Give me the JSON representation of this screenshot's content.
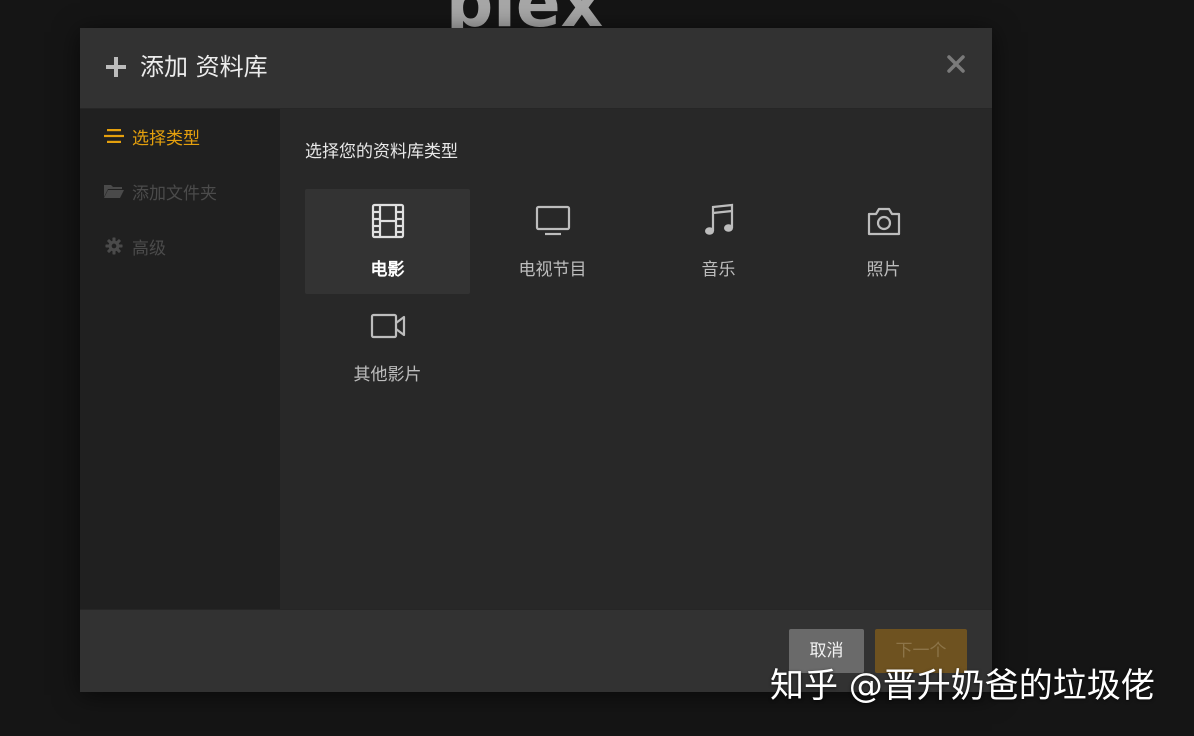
{
  "background": {
    "color": "#151515"
  },
  "logo": {
    "text": "plex",
    "text_color": "#aaaaaa",
    "accent": "#e5a00d"
  },
  "modal": {
    "title": "添加 资料库",
    "title_icon": "plus-icon",
    "close_icon": "close-icon"
  },
  "sidebar": {
    "items": [
      {
        "label": "选择类型",
        "icon": "list-icon",
        "state": "active"
      },
      {
        "label": "添加文件夹",
        "icon": "folder-icon",
        "state": "disabled"
      },
      {
        "label": "高级",
        "icon": "gear-icon",
        "state": "disabled"
      }
    ]
  },
  "content": {
    "heading": "选择您的资料库类型",
    "types": [
      {
        "label": "电影",
        "icon": "film-icon",
        "selected": true
      },
      {
        "label": "电视节目",
        "icon": "tv-icon",
        "selected": false
      },
      {
        "label": "音乐",
        "icon": "music-icon",
        "selected": false
      },
      {
        "label": "照片",
        "icon": "camera-icon",
        "selected": false
      },
      {
        "label": "其他影片",
        "icon": "video-camera-icon",
        "selected": false
      }
    ]
  },
  "footer": {
    "cancel_label": "取消",
    "next_label": "下一个"
  },
  "watermark": {
    "text": "知乎 @晋升奶爸的垃圾佬"
  },
  "colors": {
    "accent": "#e5a00d",
    "modal_bg": "#2a2a2a",
    "header_bg": "#323232",
    "sidebar_bg": "#202020"
  }
}
